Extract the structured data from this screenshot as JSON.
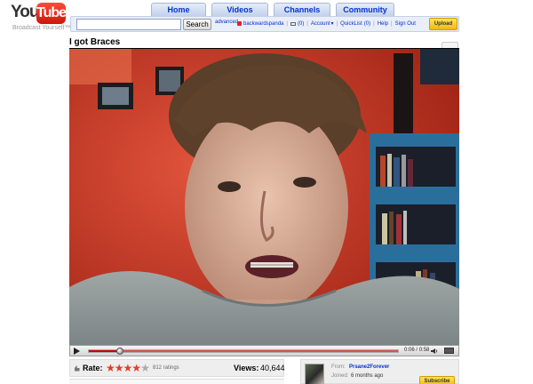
{
  "header": {
    "logo_you": "You",
    "logo_tube": "Tube",
    "tagline": "Broadcast Yourself™"
  },
  "tabs": [
    {
      "label": "Home"
    },
    {
      "label": "Videos"
    },
    {
      "label": "Channels"
    },
    {
      "label": "Community"
    }
  ],
  "search": {
    "value": "",
    "button_label": "Search",
    "advanced_label": "advanced"
  },
  "user_bar": {
    "username": "backwardspanda",
    "subscriptions": "(0)",
    "account_label": "Account",
    "quicklist_label": "QuickList",
    "quicklist_count": "(0)",
    "help_label": "Help",
    "signout_label": "Sign Out",
    "upload_label": "Upload"
  },
  "video": {
    "title": "I got Braces",
    "time_current": "0:06",
    "time_total": "0:58",
    "progress_played": 0.1,
    "progress_buffered": 1.0
  },
  "stats": {
    "rate_label": "Rate:",
    "rating": 4,
    "max_rating": 5,
    "ratings_count": "812 ratings",
    "views_label": "Views:",
    "views_value": "40,644"
  },
  "channel": {
    "from_label": "From:",
    "name": "Prsane2Forever",
    "joined_label": "Joined:",
    "joined_value": "6 months ago",
    "subscribe_label": "Subscribe"
  },
  "colors": {
    "link": "#0033cc",
    "upload_button": "#f2b80f",
    "star_on": "#e33b2c",
    "progress": "#cc0000"
  },
  "icons": {
    "play": "play-icon",
    "volume": "volume-icon",
    "fullscreen": "fullscreen-icon",
    "rate": "thumb-icon"
  }
}
